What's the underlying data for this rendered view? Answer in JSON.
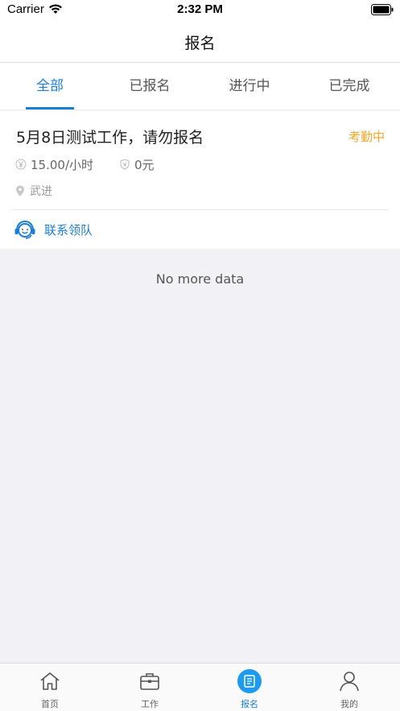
{
  "status_bar": {
    "carrier": "Carrier",
    "time": "2:32 PM"
  },
  "nav": {
    "title": "报名"
  },
  "tabs": [
    {
      "label": "全部",
      "active": true
    },
    {
      "label": "已报名",
      "active": false
    },
    {
      "label": "进行中",
      "active": false
    },
    {
      "label": "已完成",
      "active": false
    }
  ],
  "card": {
    "title": "5月8日测试工作，请勿报名",
    "status": "考勤中",
    "wage": "15.00/小时",
    "deposit": "0元",
    "location": "武进",
    "contact_label": "联系领队"
  },
  "list_footer": "No more data",
  "tabbar": [
    {
      "label": "首页",
      "icon": "home-icon",
      "active": false
    },
    {
      "label": "工作",
      "icon": "briefcase-icon",
      "active": false
    },
    {
      "label": "报名",
      "icon": "document-icon",
      "active": true
    },
    {
      "label": "我的",
      "icon": "person-icon",
      "active": false
    }
  ],
  "colors": {
    "accent": "#1a7fd4",
    "status": "#f5a623",
    "background": "#f2f2f6"
  }
}
